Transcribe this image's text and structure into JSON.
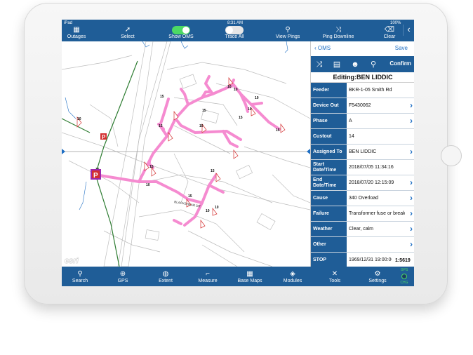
{
  "status_bar": {
    "carrier": "iPad",
    "time": "8:31 AM",
    "battery": "100%"
  },
  "toolbar": {
    "outages": "Outages",
    "select": "Select",
    "show_oms": "Show OMS",
    "trace_all": "Trace All",
    "view_pings": "View Pings",
    "ping_downline": "Ping Downline",
    "clear": "Clear"
  },
  "map": {
    "street_label": "BLACKSHEAR DR",
    "device_labels": [
      "10",
      "10",
      "15",
      "15",
      "15",
      "10",
      "15",
      "15",
      "15",
      "10",
      "15",
      "10",
      "15",
      "10",
      "10",
      "10",
      "15",
      "15"
    ],
    "marker_label": "P",
    "attribution": "esri"
  },
  "panel": {
    "back_label": "OMS",
    "save_label": "Save",
    "confirm_label": "Confirm",
    "title": "Editing:BEN LIDDIC",
    "rows": [
      {
        "label": "Feeder",
        "value": "BKR-1-05 Smith Rd",
        "chevron": false
      },
      {
        "label": "Device Out",
        "value": "F5430062",
        "chevron": true
      },
      {
        "label": "Phase",
        "value": "A",
        "chevron": true
      },
      {
        "label": "Custout",
        "value": "14",
        "chevron": false
      },
      {
        "label": "Assigned To",
        "value": "BEN LIDDIC",
        "chevron": true
      },
      {
        "label": "Start Date/Time",
        "value": "2018/07/05 11:34:16",
        "chevron": false
      },
      {
        "label": "End Date/Time",
        "value": "2018/07/20 12:15:09",
        "chevron": true
      },
      {
        "label": "Cause",
        "value": "340 Overload",
        "chevron": true
      },
      {
        "label": "Failure",
        "value": "Transformer fuse or breaker",
        "chevron": true
      },
      {
        "label": "Weather",
        "value": "Clear, calm",
        "chevron": true
      },
      {
        "label": "Other",
        "value": "",
        "chevron": true
      },
      {
        "label": "STOP",
        "value": "1969/12/31 19:00:00",
        "chevron": true
      }
    ]
  },
  "scale": "1:5619",
  "gps_status": {
    "top": "GPS",
    "bottom": "CHG"
  },
  "bottom_bar": {
    "search": "Search",
    "gps": "GPS",
    "extent": "Extent",
    "measure": "Measure",
    "base_maps": "Base Maps",
    "modules": "Modules",
    "tools": "Tools",
    "settings": "Settings"
  },
  "colors": {
    "toolbar": "#1f5d97",
    "trace": "#f58bd0",
    "feeder_line": "#2e7d32",
    "link": "#1f6fc4"
  }
}
